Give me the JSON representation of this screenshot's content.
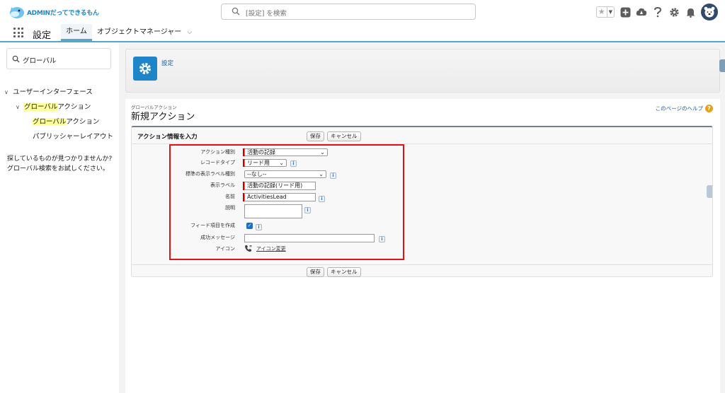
{
  "header": {
    "logo_text": "ADMINだってできるもん",
    "search_placeholder": "[設定] を検索"
  },
  "nav": {
    "app_name": "設定",
    "tabs": [
      {
        "label": "ホーム"
      },
      {
        "label": "オブジェクトマネージャー"
      }
    ]
  },
  "sidebar": {
    "quick_find_value": "グローバル",
    "tree": [
      {
        "label": "ユーザーインターフェース"
      },
      {
        "label_hl": "グローバル",
        "label_rest": "アクション"
      },
      {
        "label_hl": "グローバル",
        "label_rest": "アクション"
      },
      {
        "label": "パブリッシャーレイアウト"
      }
    ],
    "help_line1": "探しているものが見つかりませんか?",
    "help_line2": "グローバル検索をお試しください。"
  },
  "banner": {
    "title": "設定"
  },
  "page": {
    "breadcrumb": "グローバルアクション",
    "title": "新規アクション",
    "help_link": "このページのヘルプ",
    "help_badge": "?"
  },
  "form": {
    "section_title": "アクション情報を入力",
    "save": "保存",
    "cancel": "キャンセル",
    "fields": {
      "action_type_label": "アクション種別",
      "action_type_value": "活動の記録",
      "record_type_label": "レコードタイプ",
      "record_type_value": "リード用",
      "std_label_type_label": "標準の表示ラベル種別",
      "std_label_type_value": "--なし--",
      "display_label_label": "表示ラベル",
      "display_label_value": "活動の記録(リード用)",
      "name_label": "名前",
      "name_value": "ActivitiesLead",
      "description_label": "説明",
      "feed_item_label": "フィード項目を作成",
      "success_msg_label": "成功メッセージ",
      "icon_label": "アイコン",
      "icon_change": "アイコン変更"
    },
    "info_glyph": "i",
    "check_glyph": "✓",
    "dropdown_glyph": "⌄"
  },
  "colors": {
    "accent": "#1e86c8",
    "highlight_box": "#e0121c",
    "required": "#cc0000",
    "search_highlight": "#ffff99"
  }
}
